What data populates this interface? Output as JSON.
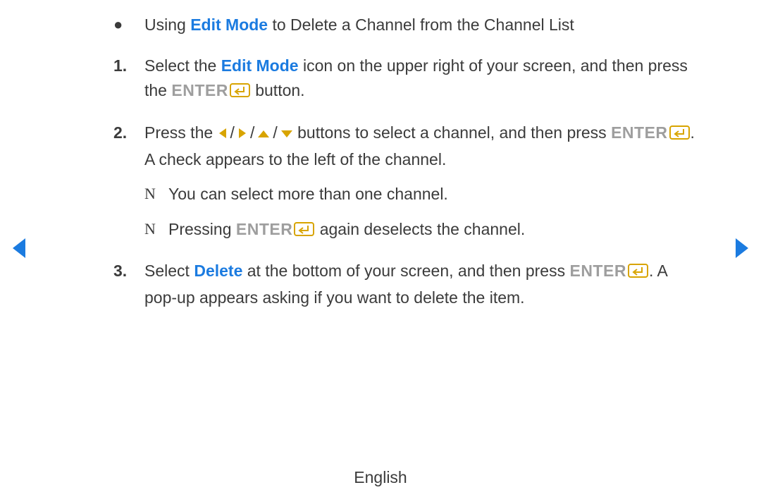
{
  "bullet": {
    "t1": "Using ",
    "editMode": "Edit Mode",
    "t2": " to Delete a Channel from the Channel List"
  },
  "step1": {
    "num": "1.",
    "a": "Select the ",
    "editMode": "Edit Mode",
    "b": " icon on the upper right of your screen, and then press the ",
    "enter": "ENTER",
    "c": " button."
  },
  "step2": {
    "num": "2.",
    "a": "Press the ",
    "b": " buttons to select a channel, and then press ",
    "enter": "ENTER",
    "c": ". A check appears to the left of the channel.",
    "slash": "/"
  },
  "note1": {
    "mark": "N",
    "text": "You can select more than one channel."
  },
  "note2": {
    "mark": "N",
    "a": "Pressing ",
    "enter": "ENTER",
    "b": " again deselects the channel."
  },
  "step3": {
    "num": "3.",
    "a": "Select ",
    "delete": "Delete",
    "b": " at the bottom of your screen, and then press ",
    "enter": "ENTER",
    "c": ". A pop-up appears asking if you want to delete the item."
  },
  "footer": "English",
  "colors": {
    "gold": "#d8a400"
  }
}
